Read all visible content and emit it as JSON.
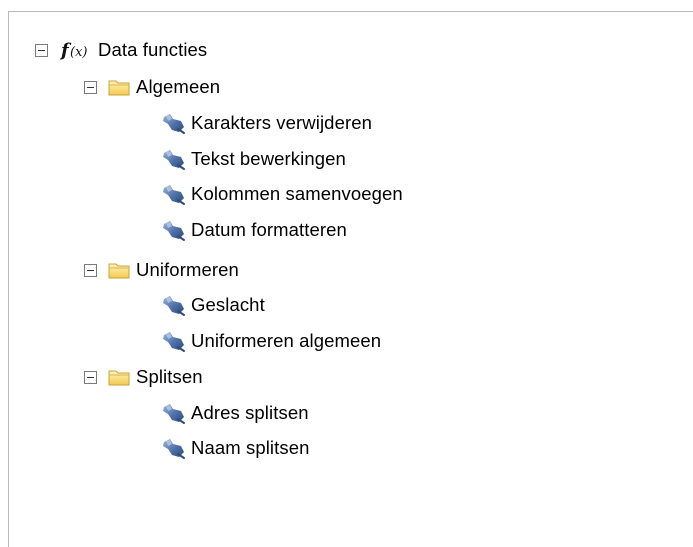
{
  "tree": {
    "root": {
      "label": "Data functies",
      "icon": "function-icon",
      "expanded": true,
      "groups": [
        {
          "label": "Algemeen",
          "icon": "folder-icon",
          "expanded": true,
          "items": [
            {
              "label": "Karakters verwijderen",
              "icon": "plug-icon"
            },
            {
              "label": "Tekst bewerkingen",
              "icon": "plug-icon"
            },
            {
              "label": "Kolommen samenvoegen",
              "icon": "plug-icon"
            },
            {
              "label": "Datum formatteren",
              "icon": "plug-icon"
            }
          ]
        },
        {
          "label": "Uniformeren",
          "icon": "folder-icon",
          "expanded": true,
          "items": [
            {
              "label": "Geslacht",
              "icon": "plug-icon"
            },
            {
              "label": "Uniformeren algemeen",
              "icon": "plug-icon"
            }
          ]
        },
        {
          "label": "Splitsen",
          "icon": "folder-icon",
          "expanded": true,
          "items": [
            {
              "label": "Adres splitsen",
              "icon": "plug-icon"
            },
            {
              "label": "Naam splitsen",
              "icon": "plug-icon"
            }
          ]
        }
      ]
    }
  },
  "colors": {
    "border": "#b9b9b9",
    "folder": "#f6d35f",
    "plug": "#4a6ea8"
  }
}
